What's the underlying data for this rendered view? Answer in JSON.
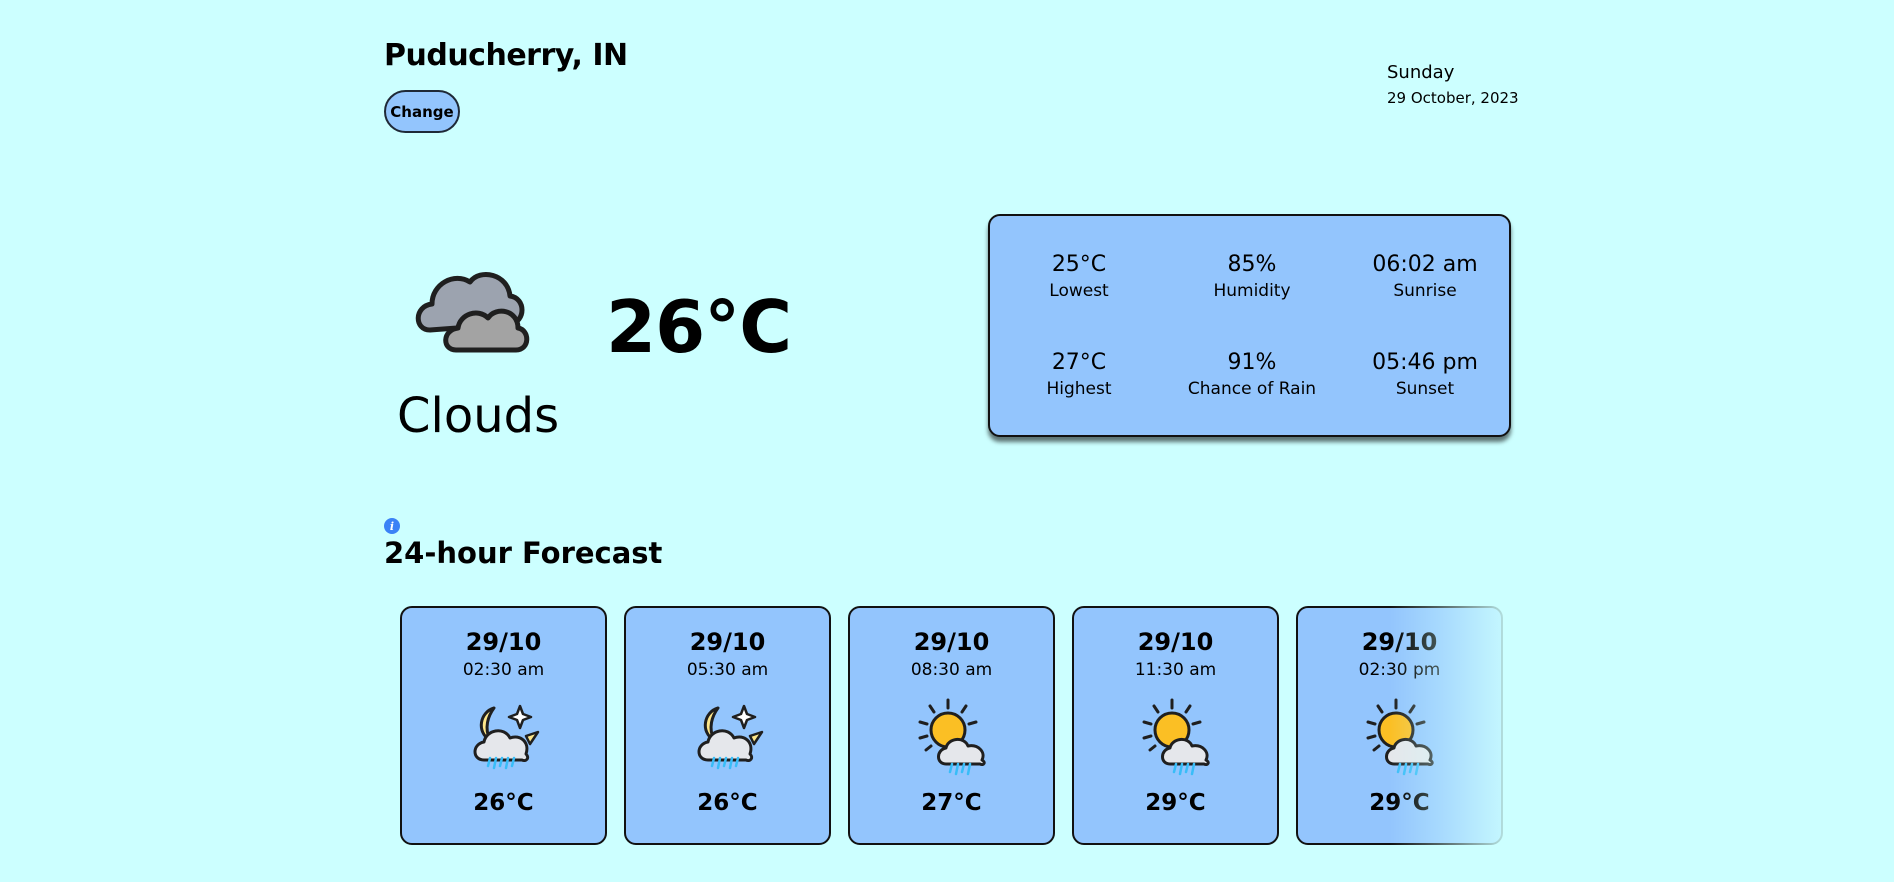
{
  "header": {
    "city": "Puducherry, IN",
    "change_label": "Change",
    "day": "Sunday",
    "date": "29 October, 2023"
  },
  "current": {
    "icon": "clouds-icon",
    "temperature": "26°C",
    "condition": "Clouds"
  },
  "stats": [
    {
      "value": "25°C",
      "label": "Lowest"
    },
    {
      "value": "85%",
      "label": "Humidity"
    },
    {
      "value": "06:02 am",
      "label": "Sunrise"
    },
    {
      "value": "27°C",
      "label": "Highest"
    },
    {
      "value": "91%",
      "label": "Chance of Rain"
    },
    {
      "value": "05:46 pm",
      "label": "Sunset"
    }
  ],
  "forecast": {
    "title": "24-hour Forecast",
    "info_icon": "info-icon",
    "items": [
      {
        "date": "29/10",
        "time": "02:30 am",
        "icon": "night-rain-icon",
        "temp": "26°C"
      },
      {
        "date": "29/10",
        "time": "05:30 am",
        "icon": "night-rain-icon",
        "temp": "26°C"
      },
      {
        "date": "29/10",
        "time": "08:30 am",
        "icon": "day-rain-icon",
        "temp": "27°C"
      },
      {
        "date": "29/10",
        "time": "11:30 am",
        "icon": "day-rain-icon",
        "temp": "29°C"
      },
      {
        "date": "29/10",
        "time": "02:30 pm",
        "icon": "day-rain-icon",
        "temp": "29°C"
      }
    ]
  },
  "colors": {
    "background": "#ccffff",
    "card": "#93c5fd",
    "info_accent": "#3b82f6",
    "sun": "#fbbf24",
    "rain": "#38bdf8"
  }
}
